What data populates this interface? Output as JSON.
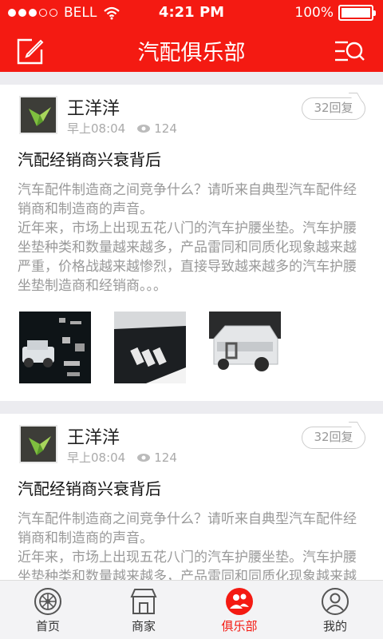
{
  "status": {
    "carrier": "BELL",
    "time": "4:21 PM",
    "battery": "100%"
  },
  "header": {
    "title": "汽配俱乐部"
  },
  "posts": [
    {
      "author": "王洋洋",
      "time": "早上08:04",
      "views": "124",
      "replies": "32回复",
      "title": "汽配经销商兴衰背后",
      "body": [
        "汽车配件制造商之间竞争什么？请听来自典型汽车配件经销商和制造商的声音。",
        "近年来，市场上出现五花八门的汽车护腰坐垫。汽车护腰坐垫种类和数量越来越多，产品雷同和同质化现象越来越严重，价格战越来越惨烈，直接导致越来越多的汽车护腰坐垫制造商和经销商。。。"
      ]
    },
    {
      "author": "王洋洋",
      "time": "早上08:04",
      "views": "124",
      "replies": "32回复",
      "title": "汽配经销商兴衰背后",
      "body": [
        "汽车配件制造商之间竞争什么？请听来自典型汽车配件经销商和制造商的声音。",
        "近年来，市场上出现五花八门的汽车护腰坐垫。汽车护腰坐垫种类和数量越来越多，产品雷同和同质化现象越来越严重，价格战越来越惨烈，直接导致越来越多的汽车护腰坐垫制造商和经销商。。。"
      ]
    }
  ],
  "tabs": [
    {
      "label": "首页",
      "icon": "wheel-icon"
    },
    {
      "label": "商家",
      "icon": "store-icon"
    },
    {
      "label": "俱乐部",
      "icon": "club-icon"
    },
    {
      "label": "我的",
      "icon": "profile-icon"
    }
  ],
  "colors": {
    "accent": "#f41a12",
    "background": "#ececf0"
  }
}
